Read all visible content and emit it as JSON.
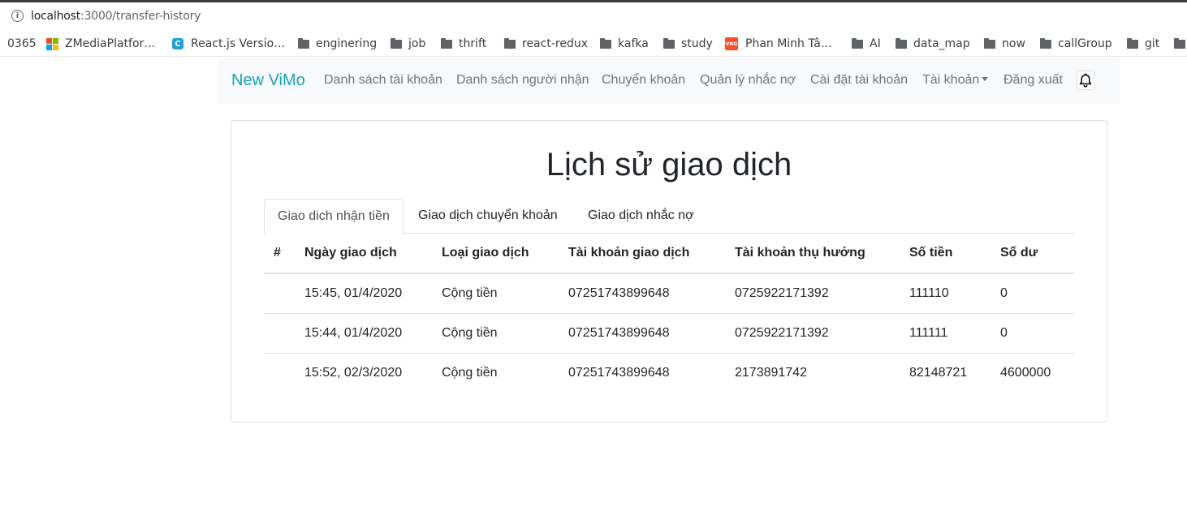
{
  "browser": {
    "url_host": "localhost",
    "url_path": ":3000/transfer-history",
    "bookmarks": [
      "0365",
      "ZMediaPlatfor…",
      "React.js Versio…",
      "enginering",
      "job",
      "thrift",
      "react-redux",
      "kafka",
      "study",
      "Phan Minh Tâ…",
      "AI",
      "data_map",
      "now",
      "callGroup",
      "git"
    ]
  },
  "navbar": {
    "brand": "New ViMo",
    "links": [
      "Danh sách tài khoản",
      "Danh sách người nhận",
      "Chuyển khoản",
      "Quản lý nhắc nợ",
      "Cài đặt tài khoản",
      "Tài khoản",
      "Đăng xuất"
    ]
  },
  "page": {
    "title": "Lịch sử giao dịch",
    "tabs": [
      "Giao dich nhận tiền",
      "Giao dịch chuyển khoản",
      "Giao dịch nhắc nợ"
    ],
    "active_tab": 0
  },
  "table": {
    "headers": [
      "#",
      "Ngày giao dịch",
      "Loại giao dịch",
      "Tài khoản giao dịch",
      "Tài khoản thụ hưởng",
      "Số tiền",
      "Số dư"
    ],
    "rows": [
      [
        "",
        "15:45, 01/4/2020",
        "Cộng tiền",
        "07251743899648",
        "0725922171392",
        "111110",
        "0"
      ],
      [
        "",
        "15:44, 01/4/2020",
        "Cộng tiền",
        "07251743899648",
        "0725922171392",
        "111111",
        "0"
      ],
      [
        "",
        "15:52, 02/3/2020",
        "Cộng tiền",
        "07251743899648",
        "2173891742",
        "82148721",
        "4600000"
      ]
    ]
  },
  "colors": {
    "brand": "#17a2b8",
    "nav_link": "#6c757d",
    "navbar_bg": "#f8f9fa"
  }
}
